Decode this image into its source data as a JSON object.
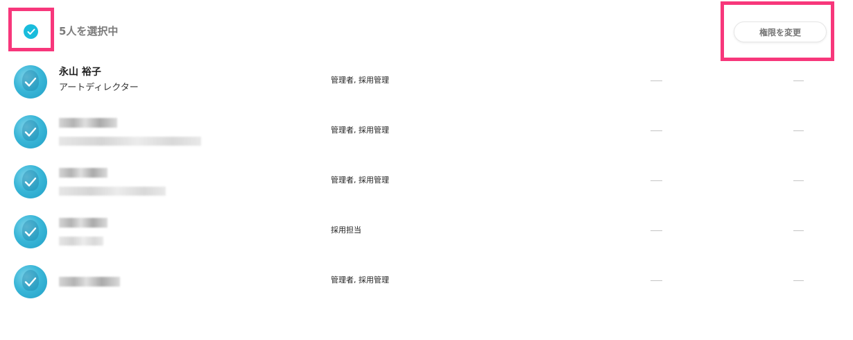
{
  "header": {
    "selected_count_label": "5人を選択中",
    "change_permission_label": "権限を変更"
  },
  "members": [
    {
      "name": "永山 裕子",
      "title": "アートディレクター",
      "roles": "管理者, 採用管理",
      "col_a": "—",
      "col_b": "—",
      "blurred": false
    },
    {
      "name": "",
      "title": "",
      "roles": "管理者, 採用管理",
      "col_a": "—",
      "col_b": "—",
      "blurred": true
    },
    {
      "name": "",
      "title": "",
      "roles": "管理者, 採用管理",
      "col_a": "—",
      "col_b": "—",
      "blurred": true
    },
    {
      "name": "",
      "title": "",
      "roles": "採用担当",
      "col_a": "—",
      "col_b": "—",
      "blurred": true
    },
    {
      "name": "",
      "title": "",
      "roles": "管理者, 採用管理",
      "col_a": "—",
      "col_b": "—",
      "blurred": true
    }
  ],
  "colors": {
    "accent": "#19bcdc",
    "highlight": "#f7377b"
  }
}
